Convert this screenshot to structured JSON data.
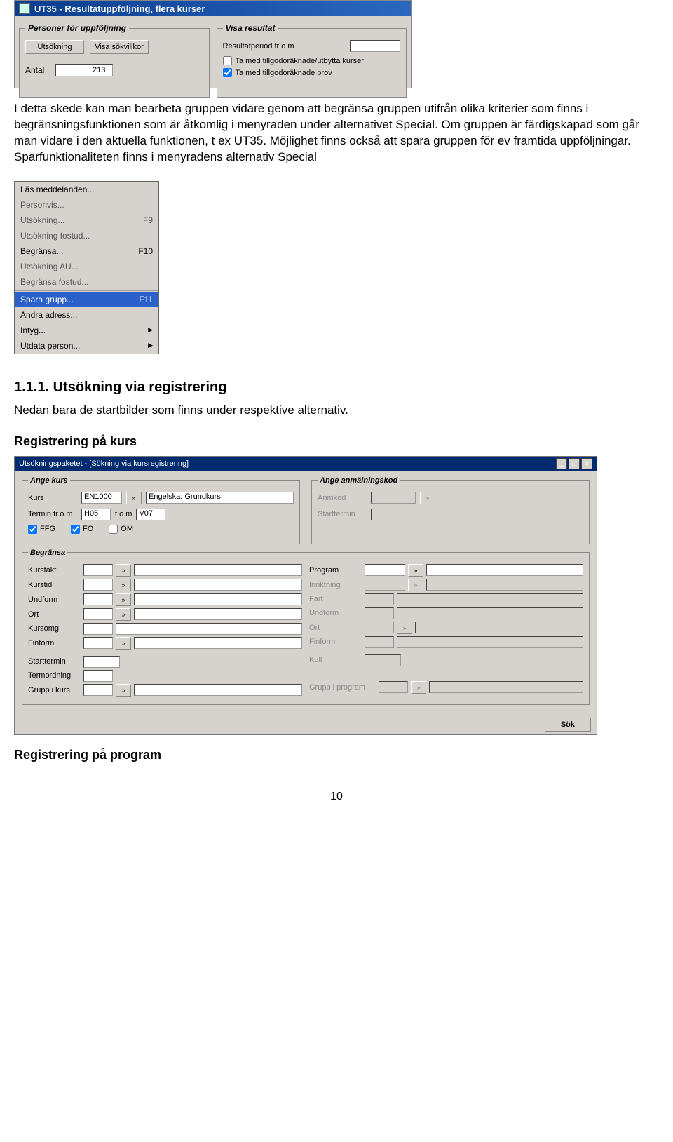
{
  "ut35": {
    "title": "UT35 - Resultatuppföljning, flera kurser",
    "left": {
      "legend": "Personer för uppföljning",
      "btn_utsok": "Utsökning",
      "btn_visa": "Visa sökvillkor",
      "antal_label": "Antal",
      "antal_value": "213"
    },
    "right": {
      "legend": "Visa resultat",
      "period_label": "Resultatperiod fr o m",
      "chk1": "Ta med tillgodoräknade/utbytta kurser",
      "chk2": "Ta med tillgodoräknade prov"
    }
  },
  "para1": "I detta skede kan man bearbeta gruppen vidare genom att begränsa gruppen utifrån olika kriterier som finns i begränsningsfunktionen som är åtkomlig i menyraden under alternativet Special. Om gruppen är färdigskapad som går man vidare i den aktuella funktionen, t ex UT35. Möjlighet finns också att spara gruppen för ev framtida uppföljningar. Sparfunktionaliteten finns i menyradens alternativ Special",
  "menu": {
    "items": [
      {
        "label": "Läs meddelanden...",
        "en": true
      },
      {
        "label": "Personvis...",
        "en": false
      },
      {
        "label": "Utsökning...",
        "en": false,
        "sc": "F9"
      },
      {
        "label": "Utsökning fostud...",
        "en": false
      },
      {
        "label": "Begränsa...",
        "en": true,
        "sc": "F10"
      },
      {
        "label": "Utsökning AU...",
        "en": false
      },
      {
        "label": "Begränsa fostud...",
        "en": false
      }
    ],
    "sel": {
      "label": "Spara grupp...",
      "sc": "F11"
    },
    "tail": [
      {
        "label": "Ändra adress...",
        "en": true
      },
      {
        "label": "Intyg...",
        "en": true,
        "sub": true
      },
      {
        "label": "Utdata person...",
        "en": true,
        "sub": true
      }
    ]
  },
  "h_111": "1.1.1. Utsökning via registrering",
  "para2": "Nedan bara de startbilder som finns under respektive alternativ.",
  "h_regkurs": "Registrering på kurs",
  "uts": {
    "title": "Utsökningspaketet - [Sökning via kursregistrering]",
    "angekurs": "Ange kurs",
    "angeanm": "Ange anmälningskod",
    "kurs_label": "Kurs",
    "kurs_code": "EN1000",
    "kurs_name": "Engelska: Grundkurs",
    "anmkod": "Anmkod",
    "termin_from": "Termin fr.o.m",
    "termin_from_v": "H05",
    "termin_tom": "t.o.m",
    "termin_tom_v": "V07",
    "starttermin": "Starttermin",
    "ffg": "FFG",
    "fo": "FO",
    "om": "OM",
    "begransa": "Begränsa",
    "left_labels": [
      "Kurstakt",
      "Kurstid",
      "Undform",
      "Ort",
      "Kursomg",
      "Finform"
    ],
    "left_extra": [
      "Starttermin",
      "Termordning",
      "Grupp i kurs"
    ],
    "right_labels": [
      "Program",
      "Inriktning",
      "Fart",
      "Undform",
      "Ort",
      "Finform"
    ],
    "right_extra": [
      "Kull",
      "Grupp i program"
    ],
    "sok": "Sök"
  },
  "h_regprog": "Registrering på program",
  "page_num": "10"
}
